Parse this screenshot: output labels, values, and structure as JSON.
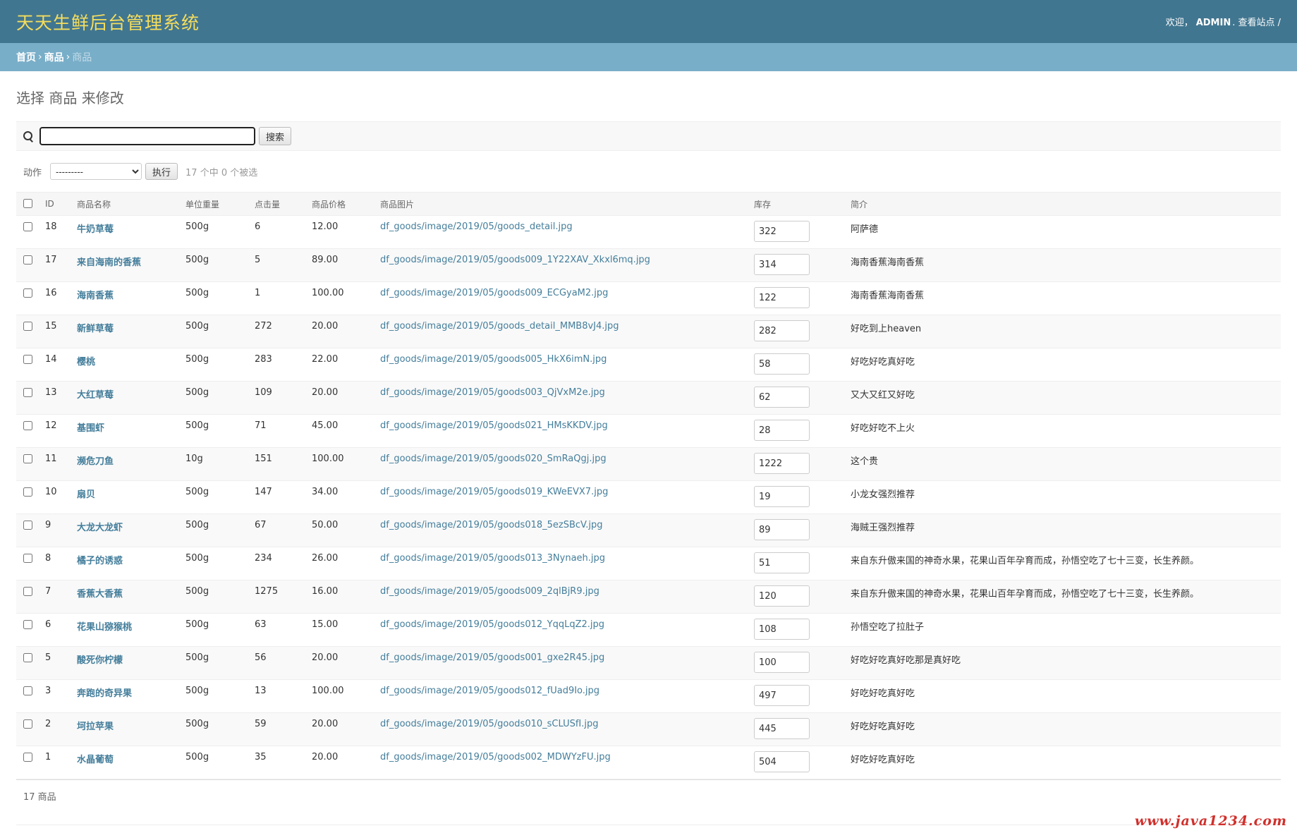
{
  "header": {
    "brand": "天天生鲜后台管理系统",
    "welcome": "欢迎，",
    "user": "ADMIN",
    "view_site": ". 查看站点 /"
  },
  "breadcrumbs": {
    "home": "首页",
    "app": "商品",
    "current": "商品",
    "sep": "›"
  },
  "page_title": "选择 商品 来修改",
  "search": {
    "value": "",
    "button": "搜索"
  },
  "actions": {
    "label": "动作",
    "selected": "---------",
    "go": "执行",
    "counter": "17 个中 0 个被选"
  },
  "columns": [
    "ID",
    "商品名称",
    "单位重量",
    "点击量",
    "商品价格",
    "商品图片",
    "库存",
    "简介"
  ],
  "rows": [
    {
      "id": "18",
      "name": "牛奶草莓",
      "unit": "500g",
      "clicks": "6",
      "price": "12.00",
      "image": "df_goods/image/2019/05/goods_detail.jpg",
      "stock": "322",
      "desc": "阿萨德"
    },
    {
      "id": "17",
      "name": "来自海南的香蕉",
      "unit": "500g",
      "clicks": "5",
      "price": "89.00",
      "image": "df_goods/image/2019/05/goods009_1Y22XAV_Xkxl6mq.jpg",
      "stock": "314",
      "desc": "海南香蕉海南香蕉"
    },
    {
      "id": "16",
      "name": "海南香蕉",
      "unit": "500g",
      "clicks": "1",
      "price": "100.00",
      "image": "df_goods/image/2019/05/goods009_ECGyaM2.jpg",
      "stock": "122",
      "desc": "海南香蕉海南香蕉"
    },
    {
      "id": "15",
      "name": "新鲜草莓",
      "unit": "500g",
      "clicks": "272",
      "price": "20.00",
      "image": "df_goods/image/2019/05/goods_detail_MMB8vJ4.jpg",
      "stock": "282",
      "desc": "好吃到上heaven"
    },
    {
      "id": "14",
      "name": "樱桃",
      "unit": "500g",
      "clicks": "283",
      "price": "22.00",
      "image": "df_goods/image/2019/05/goods005_HkX6imN.jpg",
      "stock": "58",
      "desc": "好吃好吃真好吃"
    },
    {
      "id": "13",
      "name": "大红草莓",
      "unit": "500g",
      "clicks": "109",
      "price": "20.00",
      "image": "df_goods/image/2019/05/goods003_QjVxM2e.jpg",
      "stock": "62",
      "desc": "又大又红又好吃"
    },
    {
      "id": "12",
      "name": "基围虾",
      "unit": "500g",
      "clicks": "71",
      "price": "45.00",
      "image": "df_goods/image/2019/05/goods021_HMsKKDV.jpg",
      "stock": "28",
      "desc": "好吃好吃不上火"
    },
    {
      "id": "11",
      "name": "濒危刀鱼",
      "unit": "10g",
      "clicks": "151",
      "price": "100.00",
      "image": "df_goods/image/2019/05/goods020_SmRaQgj.jpg",
      "stock": "1222",
      "desc": "这个贵"
    },
    {
      "id": "10",
      "name": "扇贝",
      "unit": "500g",
      "clicks": "147",
      "price": "34.00",
      "image": "df_goods/image/2019/05/goods019_KWeEVX7.jpg",
      "stock": "19",
      "desc": "小龙女强烈推荐"
    },
    {
      "id": "9",
      "name": "大龙大龙虾",
      "unit": "500g",
      "clicks": "67",
      "price": "50.00",
      "image": "df_goods/image/2019/05/goods018_5ezSBcV.jpg",
      "stock": "89",
      "desc": "海贼王强烈推荐"
    },
    {
      "id": "8",
      "name": "橘子的诱惑",
      "unit": "500g",
      "clicks": "234",
      "price": "26.00",
      "image": "df_goods/image/2019/05/goods013_3Nynaeh.jpg",
      "stock": "51",
      "desc": "来自东升傲来国的神奇水果，花果山百年孕育而成，孙悟空吃了七十三变，长生养颜。"
    },
    {
      "id": "7",
      "name": "香蕉大香蕉",
      "unit": "500g",
      "clicks": "1275",
      "price": "16.00",
      "image": "df_goods/image/2019/05/goods009_2qlBjR9.jpg",
      "stock": "120",
      "desc": "来自东升傲来国的神奇水果，花果山百年孕育而成，孙悟空吃了七十三变，长生养颜。"
    },
    {
      "id": "6",
      "name": "花果山猕猴桃",
      "unit": "500g",
      "clicks": "63",
      "price": "15.00",
      "image": "df_goods/image/2019/05/goods012_YqqLqZ2.jpg",
      "stock": "108",
      "desc": "孙悟空吃了拉肚子"
    },
    {
      "id": "5",
      "name": "酸死你柠檬",
      "unit": "500g",
      "clicks": "56",
      "price": "20.00",
      "image": "df_goods/image/2019/05/goods001_gxe2R45.jpg",
      "stock": "100",
      "desc": "好吃好吃真好吃那是真好吃"
    },
    {
      "id": "3",
      "name": "奔跑的奇异果",
      "unit": "500g",
      "clicks": "13",
      "price": "100.00",
      "image": "df_goods/image/2019/05/goods012_fUad9Io.jpg",
      "stock": "497",
      "desc": "好吃好吃真好吃"
    },
    {
      "id": "2",
      "name": "坷拉苹果",
      "unit": "500g",
      "clicks": "59",
      "price": "20.00",
      "image": "df_goods/image/2019/05/goods010_sCLUSfI.jpg",
      "stock": "445",
      "desc": "好吃好吃真好吃"
    },
    {
      "id": "1",
      "name": "水晶葡萄",
      "unit": "500g",
      "clicks": "35",
      "price": "20.00",
      "image": "df_goods/image/2019/05/goods002_MDWYzFU.jpg",
      "stock": "504",
      "desc": "好吃好吃真好吃"
    }
  ],
  "paginator": "17 商品",
  "watermark": "www.java1234.com"
}
